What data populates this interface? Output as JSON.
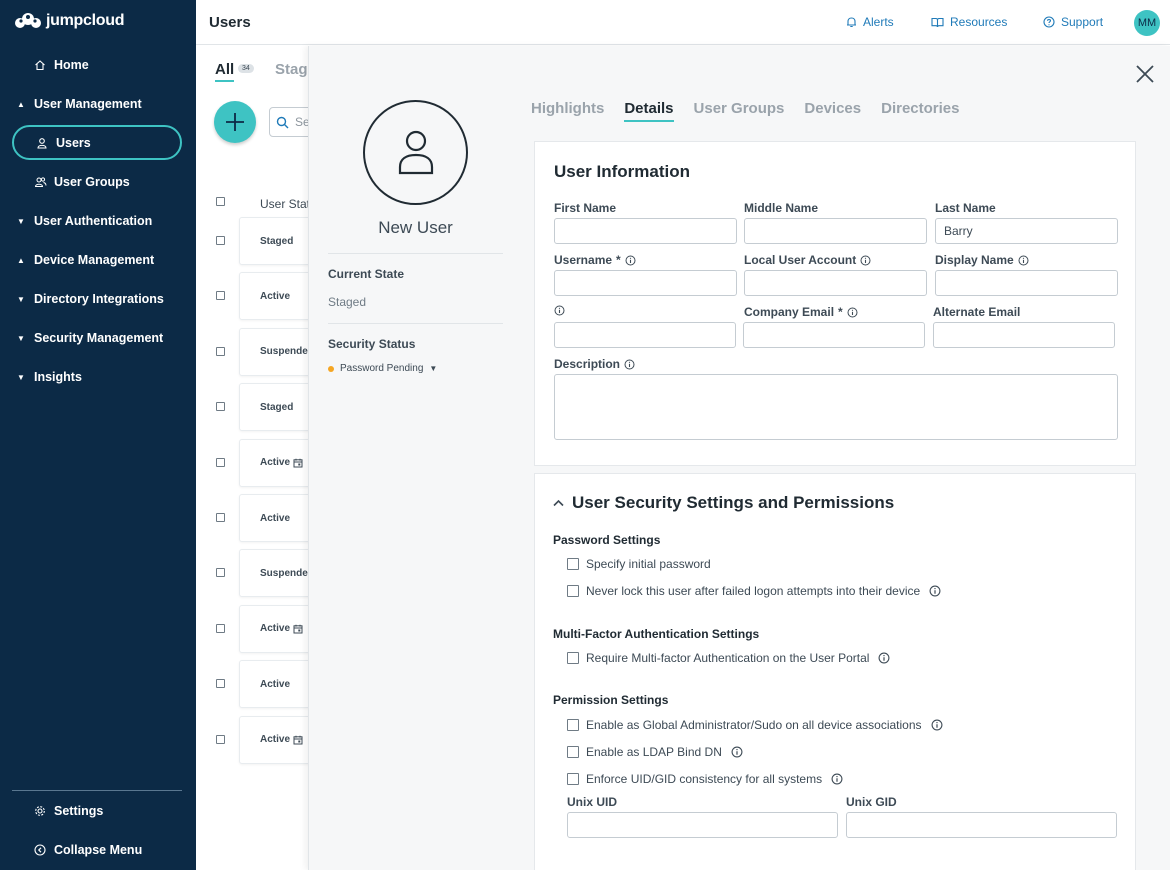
{
  "app": {
    "brand": "jumpcloud",
    "page_title": "Users"
  },
  "header": {
    "alerts": "Alerts",
    "resources": "Resources",
    "support": "Support",
    "avatar_initials": "MM"
  },
  "sidebar": {
    "home": "Home",
    "user_management": "User Management",
    "users": "Users",
    "user_groups": "User Groups",
    "user_authentication": "User Authentication",
    "device_management": "Device Management",
    "directory_integrations": "Directory Integrations",
    "security_management": "Security Management",
    "insights": "Insights",
    "settings": "Settings",
    "collapse_menu": "Collapse Menu"
  },
  "list": {
    "tab_all": "All",
    "tab_all_count": "34",
    "tab_staged": "Stag",
    "search_placeholder": "Se",
    "column_header": "User Stat",
    "rows": [
      {
        "status": "Staged",
        "calendar": false
      },
      {
        "status": "Active",
        "calendar": false
      },
      {
        "status": "Suspende",
        "calendar": false
      },
      {
        "status": "Staged",
        "calendar": false
      },
      {
        "status": "Active",
        "calendar": true
      },
      {
        "status": "Active",
        "calendar": false
      },
      {
        "status": "Suspende",
        "calendar": false
      },
      {
        "status": "Active",
        "calendar": true
      },
      {
        "status": "Active",
        "calendar": false
      },
      {
        "status": "Active",
        "calendar": true
      }
    ]
  },
  "panel": {
    "user_name": "New User",
    "current_state_label": "Current State",
    "current_state_value": "Staged",
    "security_status_label": "Security Status",
    "security_status_value": "Password Pending",
    "tabs": [
      "Highlights",
      "Details",
      "User Groups",
      "Devices",
      "Directories"
    ],
    "active_tab": "Details"
  },
  "user_info": {
    "title": "User Information",
    "first_name_label": "First Name",
    "first_name_value": "",
    "middle_name_label": "Middle Name",
    "middle_name_value": "",
    "last_name_label": "Last Name",
    "last_name_value": "Barry",
    "username_label": "Username",
    "required_marker": "*",
    "local_user_account_label": "Local User Account",
    "display_name_label": "Display Name",
    "company_email_label": "Company Email",
    "alternate_email_label": "Alternate Email",
    "description_label": "Description"
  },
  "security": {
    "title": "User Security Settings and Permissions",
    "password_settings": "Password Settings",
    "specify_initial_password": "Specify initial password",
    "never_lock": "Never lock this user after failed logon attempts into their device",
    "mfa_settings": "Multi-Factor Authentication Settings",
    "require_mfa": "Require Multi-factor Authentication on the User Portal",
    "permission_settings": "Permission Settings",
    "global_admin": "Enable as Global Administrator/Sudo on all device associations",
    "ldap_bind": "Enable as LDAP Bind DN",
    "enforce_uid_gid": "Enforce UID/GID consistency for all systems",
    "unix_uid_label": "Unix UID",
    "unix_gid_label": "Unix GID"
  },
  "colors": {
    "sidebar_bg": "#0c2a46",
    "accent": "#3ec3c3",
    "link": "#1f7ab8",
    "status_pending": "#f5a623"
  }
}
